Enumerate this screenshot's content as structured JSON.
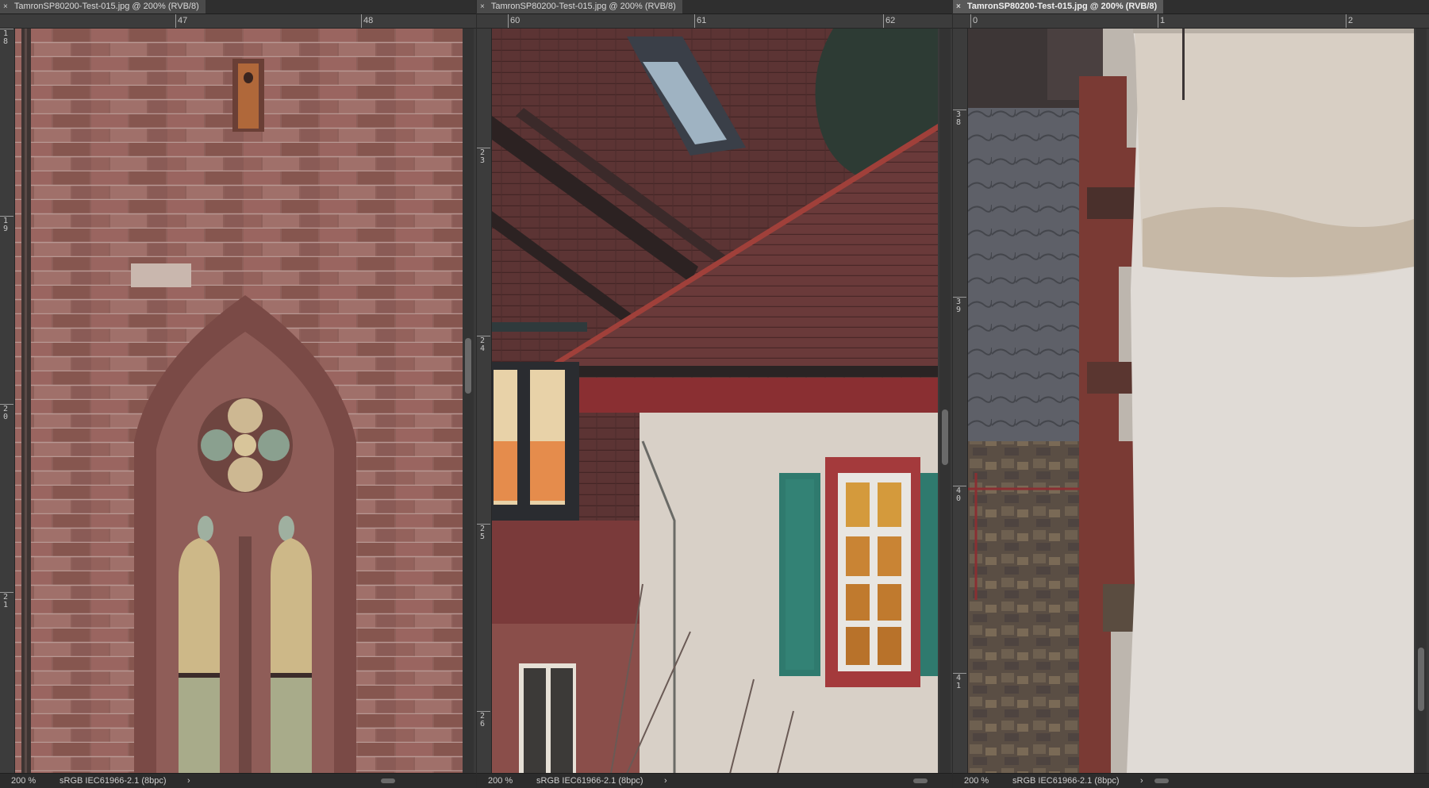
{
  "documents": [
    {
      "title": "TamronSP80200-Test-015.jpg @ 200% (RVB/8)",
      "active": false,
      "ruler_h": [
        "47",
        "48"
      ],
      "ruler_v": [
        "1\n8",
        "1\n9",
        "2\n0",
        "2\n1"
      ],
      "zoom": "200 %",
      "profile": "sRGB IEC61966-2.1 (8bpc)"
    },
    {
      "title": "TamronSP80200-Test-015.jpg @ 200% (RVB/8)",
      "active": false,
      "ruler_h": [
        "60",
        "61",
        "62"
      ],
      "ruler_v": [
        "2\n3",
        "2\n4",
        "2\n5",
        "2\n6"
      ],
      "zoom": "200 %",
      "profile": "sRGB IEC61966-2.1 (8bpc)"
    },
    {
      "title": "TamronSP80200-Test-015.jpg @ 200% (RVB/8)",
      "active": true,
      "ruler_h": [
        "0",
        "1",
        "2"
      ],
      "ruler_v": [
        "3\n8",
        "3\n9",
        "4\n0",
        "4\n1"
      ],
      "zoom": "200 %",
      "profile": "sRGB IEC61966-2.1 (8bpc)"
    }
  ],
  "icons": {
    "close": "close-icon",
    "chevron": "chevron-right-icon"
  },
  "glyphs": {
    "close": "×",
    "chevron": "›"
  },
  "colors": {
    "sandstone": "#8a5a55",
    "roof": "#5a3232",
    "shutter": "#2f7a6e",
    "plaster": "#d9d3cc"
  }
}
